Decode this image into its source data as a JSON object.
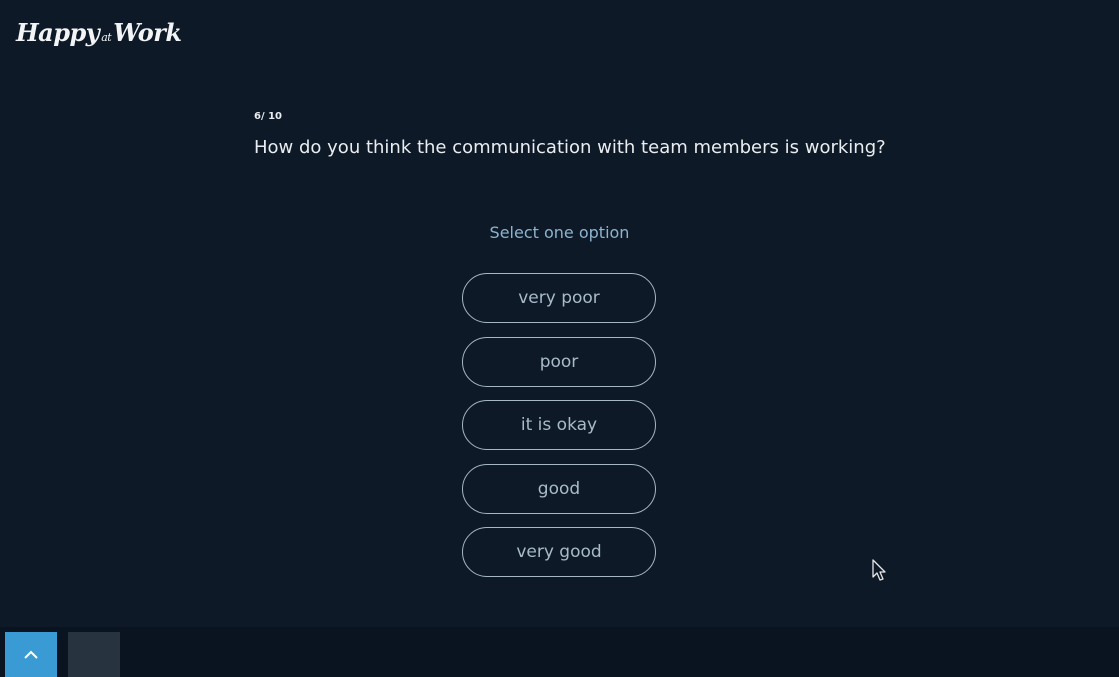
{
  "brand": {
    "part1": "Happy",
    "part2": "at",
    "part3": "Work"
  },
  "survey": {
    "progress": "6/ 10",
    "question": "How do you think the communication with team members is working?",
    "instruction": "Select one option",
    "options": [
      "very poor",
      "poor",
      "it is okay",
      "good",
      "very good"
    ]
  },
  "navigation": {
    "up_icon": "chevron-up-icon",
    "down_icon": "chevron-down-icon"
  },
  "colors": {
    "background": "#0d1926",
    "accent": "#3a9ad4",
    "instruction": "#8eb3cf"
  }
}
